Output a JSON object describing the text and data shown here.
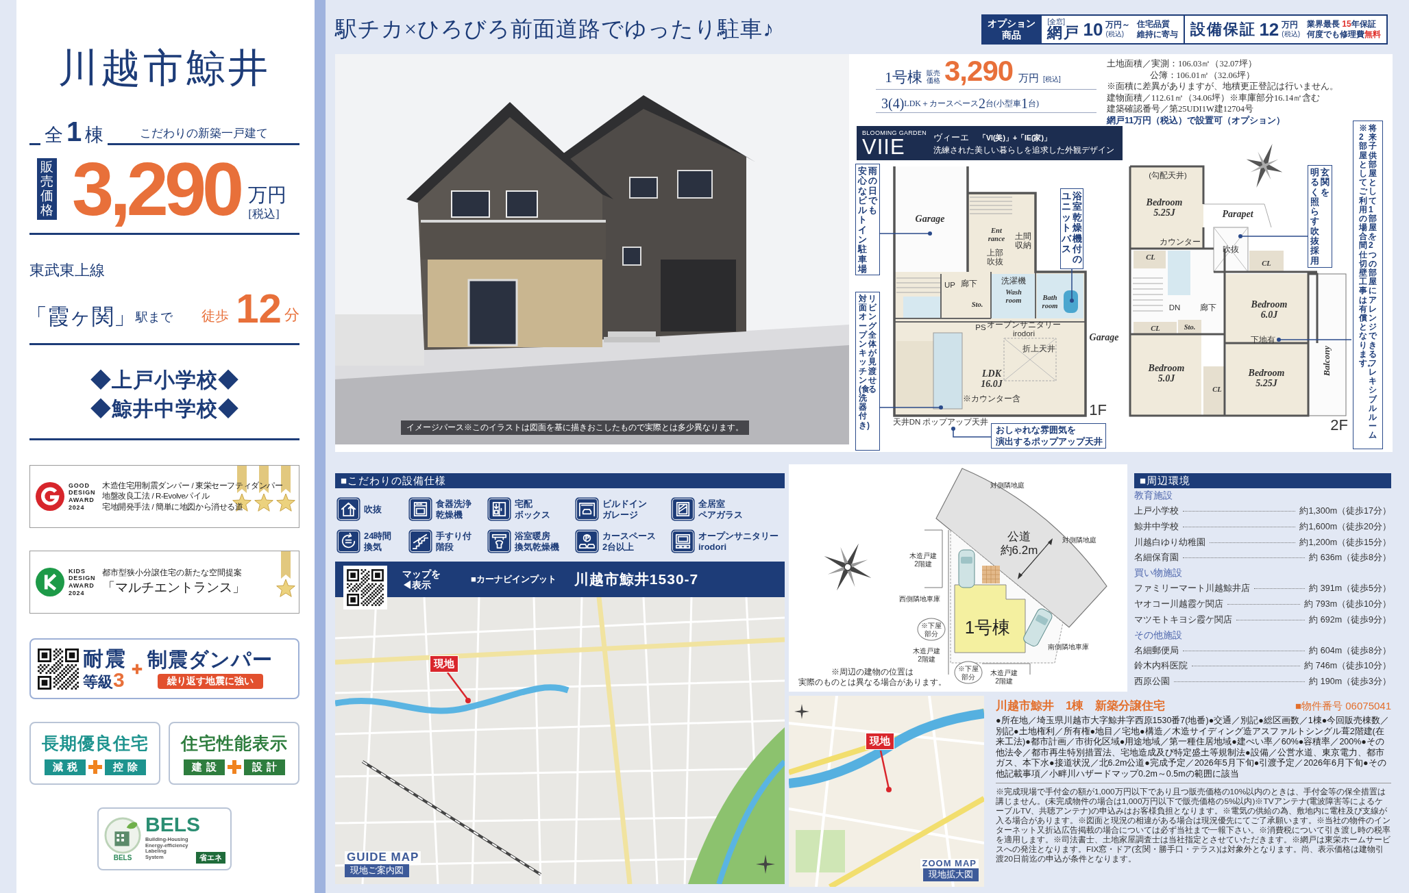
{
  "left_panel": {
    "title": "川越市鯨井",
    "count_line": [
      {
        "text": "全",
        "big": false
      },
      {
        "text": "1",
        "big": true
      },
      {
        "text": "棟",
        "big": false
      }
    ],
    "tagline": "こだわりの新築一戸建て",
    "price": {
      "label": "販売価格",
      "amount": "3,290",
      "unit": "万円",
      "tax": "[税込]"
    },
    "access": {
      "line": "東武東上線",
      "station": "「霞ヶ関」",
      "station_suffix": "駅まで",
      "walk_label": "徒歩",
      "minutes": "12",
      "minutes_unit": "分"
    },
    "schools": [
      "◆上戸小学校◆",
      "◆鯨井中学校◆"
    ],
    "awards": [
      {
        "kind": "good_design",
        "logo_text": [
          "GOOD",
          "DESIGN",
          "AWARD",
          "2024"
        ],
        "lines": [
          "木造住宅用制震ダンパー / 東栄セーフティダンパー",
          "地盤改良工法 / R-Evolveパイル",
          "宅地開発手法 / 簡単に地図から消せる道"
        ]
      },
      {
        "kind": "kids_design",
        "logo_text": [
          "KIDS",
          "DESIGN",
          "AWARD",
          "2024"
        ],
        "lines": [
          "都市型狭小分譲住宅の新たな空間提案"
        ],
        "title": "「マルチエントランス」"
      }
    ],
    "seismic": {
      "title": "耐震",
      "grade_label": "等級",
      "grade": "3",
      "damper": "制震ダンパー",
      "slogan": "繰り返す地震に強い"
    },
    "certifications": [
      {
        "title": "長期優良住宅",
        "tags": [
          "減税",
          "控除"
        ],
        "color": "#1d938e"
      },
      {
        "title": "住宅性能表示",
        "tags": [
          "建設",
          "設計"
        ],
        "color": "#2e7d3e"
      }
    ],
    "bels": {
      "mark": "BELS",
      "title": "BELS",
      "lines": [
        "Building-Housing",
        "Energy-efficiency",
        "Labeling",
        "System"
      ],
      "tag": "省エネ"
    }
  },
  "headline": "駅チカ×ひろびろ前面道路でゆったり駐車♪",
  "option_bar": {
    "label": [
      "オプション",
      "商品"
    ],
    "items": [
      {
        "tag": "[全窓]",
        "name": "網戸",
        "amount": "10",
        "unit": "万円～",
        "tax": "(税込)",
        "notes": [
          [
            {
              "text": "住宅品質",
              "accent": false
            }
          ],
          [
            {
              "text": "維持に寄与",
              "accent": false
            }
          ]
        ]
      },
      {
        "name": "設備保証",
        "amount": "12",
        "unit": "万円",
        "tax": "(税込)",
        "notes": [
          [
            {
              "text": "業界最長 ",
              "accent": false
            },
            {
              "text": "15",
              "accent": true
            },
            {
              "text": "年保証",
              "accent": false
            }
          ],
          [
            {
              "text": "何度でも修理費",
              "accent": false
            },
            {
              "text": "無料",
              "accent": true
            }
          ]
        ]
      }
    ]
  },
  "house_image": {
    "caption": "イメージパース※このイラストは図面を基に描きおこしたもので実際とは多少異なります。"
  },
  "summary": {
    "unit": "1号棟",
    "price_label": "販売価格",
    "price": "3,290",
    "price_unit": "万円",
    "tax": "[税込]",
    "layout": [
      {
        "text": "3(4)",
        "big": true
      },
      {
        "text": "LDK＋カースペース",
        "big": false
      },
      {
        "text": "2",
        "big": true
      },
      {
        "text": "台(小型車",
        "big": false
      },
      {
        "text": "1",
        "big": true
      },
      {
        "text": "台)",
        "big": false
      }
    ]
  },
  "specs": [
    {
      "text": "土地面積／実測：106.03㎡（32.07坪）",
      "kind": "plain"
    },
    {
      "text": "公簿：106.01㎡（32.06坪）",
      "kind": "indent"
    },
    {
      "text": "※面積に差異がありますが、地積更正登記は行いません。",
      "kind": "plain"
    },
    {
      "text": "建物面積／112.61㎡（34.06坪）※車庫部分16.14㎡含む",
      "kind": "plain"
    },
    {
      "text": "建築確認番号／第25UDI1W建12704号",
      "kind": "plain"
    },
    {
      "text": "網戸11万円（税込）で設置可（オプション）",
      "kind": "highlight"
    }
  ],
  "brand": {
    "label": "BLOOMING GARDEN",
    "logo": "VIIE",
    "reading": "ヴィーエ",
    "formula": "「VI(美)」+「IE(家)」",
    "tagline": "洗練された美しい暮らしを追求した外観デザイン"
  },
  "floor_plans": [
    {
      "floor": "1F",
      "labels": [
        {
          "text": "Garage",
          "kind": "room"
        },
        {
          "text": "Ent\nrance",
          "kind": "room_small"
        },
        {
          "text": "土間収納",
          "kind": "stack"
        },
        {
          "text": "上部吹抜",
          "kind": "stack"
        },
        {
          "text": "洗濯機",
          "kind": "note"
        },
        {
          "text": "UP",
          "kind": "note"
        },
        {
          "text": "廊下",
          "kind": "note"
        },
        {
          "text": "Wash\nroom",
          "kind": "room_small"
        },
        {
          "text": "Bath\nroom",
          "kind": "room_small"
        },
        {
          "text": "Sto.",
          "kind": "room_small"
        },
        {
          "text": "PS",
          "kind": "note"
        },
        {
          "text": "オープンサニタリー\nirodori",
          "kind": "note"
        },
        {
          "text": "LDK\n16.0J",
          "kind": "room"
        },
        {
          "text": "※カウンター含",
          "kind": "note"
        },
        {
          "text": "折上天井",
          "kind": "note"
        },
        {
          "text": "Garage",
          "kind": "room"
        },
        {
          "text": "天井DN",
          "kind": "note"
        },
        {
          "text": "ポップアップ天井",
          "kind": "note"
        }
      ]
    },
    {
      "floor": "2F",
      "labels": [
        {
          "text": "(勾配天井)",
          "kind": "note"
        },
        {
          "text": "Bedroom\n5.25J",
          "kind": "room"
        },
        {
          "text": "Parapet",
          "kind": "room"
        },
        {
          "text": "カウンター",
          "kind": "note"
        },
        {
          "text": "吹抜",
          "kind": "note"
        },
        {
          "text": "CL",
          "kind": "room_small"
        },
        {
          "text": "CL",
          "kind": "room_small"
        },
        {
          "text": "DN",
          "kind": "note"
        },
        {
          "text": "廊下",
          "kind": "note"
        },
        {
          "text": "Bedroom\n6.0J",
          "kind": "room"
        },
        {
          "text": "CL",
          "kind": "room_small"
        },
        {
          "text": "Sto.",
          "kind": "room_small"
        },
        {
          "text": "下地有",
          "kind": "note"
        },
        {
          "text": "Bedroom\n5.0J",
          "kind": "room"
        },
        {
          "text": "CL",
          "kind": "room_small"
        },
        {
          "text": "Bedroom\n5.25J",
          "kind": "room"
        },
        {
          "text": "Balcony",
          "kind": "side"
        }
      ]
    }
  ],
  "plan_callouts": [
    {
      "kind": "vertical",
      "text": "雨の日でも安心なビルトイン駐車場"
    },
    {
      "kind": "vertical",
      "text": "浴室乾燥機付のユニットバス"
    },
    {
      "kind": "vertical",
      "text": "リビング全体が見渡せる対面オープンキッチン(食洗器付き)"
    },
    {
      "kind": "horizontal",
      "text": "おしゃれな雰囲気を演出するポップアップ天井"
    },
    {
      "kind": "vertical",
      "text": "玄関を明るく照らす吹抜採用"
    }
  ],
  "plan_note": {
    "text": "将来子供部屋として1部屋を2つの部屋にアレンジできるフレキシブルルーム※2部屋としてご利用の場合、間仕切壁工事は有償となります。"
  },
  "features": {
    "title": "■こだわりの設備仕様",
    "items": [
      {
        "lines": [
          "吹抜"
        ]
      },
      {
        "lines": [
          "食器洗浄",
          "乾燥機"
        ]
      },
      {
        "lines": [
          "宅配",
          "ボックス"
        ]
      },
      {
        "lines": [
          "ビルドイン",
          "ガレージ"
        ]
      },
      {
        "lines": [
          "全居室",
          "ペアガラス"
        ]
      },
      {
        "lines": [
          "24時間",
          "換気"
        ]
      },
      {
        "lines": [
          "手すり付",
          "階段"
        ]
      },
      {
        "lines": [
          "浴室暖房",
          "換気乾燥機"
        ]
      },
      {
        "lines": [
          "カースペース",
          "2台以上"
        ]
      },
      {
        "lines": [
          "オープンサニタリー",
          "irodori"
        ]
      }
    ]
  },
  "map_bar": {
    "qr_hint": [
      "マップを",
      "◀表示"
    ],
    "nav_label": "■カーナビインプット",
    "address": "川越市鯨井1530-7"
  },
  "guide_map": {
    "pin": "現地",
    "title": "GUIDE MAP",
    "subtitle": "現地ご案内図"
  },
  "site_plan": {
    "labels": [
      {
        "text": "対側隣地庭",
        "kind": "note"
      },
      {
        "text": "対側隣地庭",
        "kind": "note"
      },
      {
        "text": "木造戸建2階建",
        "kind": "stack"
      },
      {
        "text": "西側隣地車庫",
        "kind": "note"
      },
      {
        "text": "※下屋部分",
        "kind": "circled"
      },
      {
        "text": "木造戸建2階建",
        "kind": "stack"
      },
      {
        "text": "※下屋部分",
        "kind": "circled"
      },
      {
        "text": "木造戸建2階建",
        "kind": "stack"
      },
      {
        "text": "南側隣地車庫",
        "kind": "note"
      }
    ],
    "road": [
      "公道",
      "約6.2m"
    ],
    "building": "1号棟",
    "note": [
      "※周辺の建物の位置は",
      "実際のものとは異なる場合があります。"
    ]
  },
  "surroundings": {
    "title": "■周辺環境",
    "groups": [
      {
        "name": "教育施設",
        "items": [
          {
            "name": "上戸小学校",
            "distance": "約1,300m（徒歩17分）"
          },
          {
            "name": "鯨井中学校",
            "distance": "約1,600m（徒歩20分）"
          },
          {
            "name": "川越白ゆり幼稚園",
            "distance": "約1,200m（徒歩15分）"
          },
          {
            "name": "名細保育園",
            "distance": "約 636m（徒歩8分）"
          }
        ]
      },
      {
        "name": "買い物施設",
        "items": [
          {
            "name": "ファミリーマート川越鯨井店",
            "distance": "約 391m（徒歩5分）"
          },
          {
            "name": "ヤオコー川越霞ケ関店",
            "distance": "約 793m（徒歩10分）"
          },
          {
            "name": "マツモトキヨシ霞ケ関店",
            "distance": "約 692m（徒歩9分）"
          }
        ]
      },
      {
        "name": "その他施設",
        "items": [
          {
            "name": "名細郵便局",
            "distance": "約 604m（徒歩8分）"
          },
          {
            "name": "鈴木内科医院",
            "distance": "約 746m（徒歩10分）"
          },
          {
            "name": "西原公園",
            "distance": "約 190m（徒歩3分）"
          }
        ]
      }
    ]
  },
  "zoom_map": {
    "pin": "現地",
    "title": "ZOOM MAP",
    "subtitle": "現地拡大図"
  },
  "property": {
    "title": "川越市鯨井　1棟　新築分譲住宅",
    "number": "■物件番号 06075041",
    "details": "●所在地／埼玉県川越市大字鯨井字西原1530番7(地番)●交通／別記●総区画数／1棟●今回販売棟数／別記●土地権利／所有権●地目／宅地●構造／木造サイディング造アスファルトシングル葺2階建(在来工法)●都市計画／市街化区域●用途地域／第一種住居地域●建ぺい率／60%●容積率／200%●その他法令／都市再生特別措置法、宅地造成及び特定盛土等規制法●設備／公営水道、東京電力、都市ガス、本下水●接道状況／北6.2m公道●完成予定／2026年5月下旬●引渡予定／2026年6月下旬●その他記載事項／小畔川ハザードマップ0.2m～0.5mの範囲に該当",
    "disclaimer": "※完成現場で手付金の額が1,000万円以下であり且つ販売価格の10%以内のときは、手付金等の保全措置は講じません。(未完成物件の場合は1,000万円以下で販売価格の5%以内)※TVアンテナ(電波障害等によるケーブルTV、共聴アンテナ)の申込みはお客様負担となります。※電気の供給の為、敷地内に電柱及び支線が入る場合があります。※図面と現況の相違がある場合は現況優先にてご了承願います。※当社の物件のインターネット又折込広告掲載の場合については必ず当社まで一報下さい。※消費税について引き渡し時の税率を適用します。※司法書士、土地家屋調査士は当社指定とさせていただきます。※網戸は東栄ホームサービスへの発注となります。FIX窓・ドア(玄関・勝手口・テラス)は対象外となります。尚、表示価格は建物引渡20日前迄の申込が条件となります。"
  }
}
